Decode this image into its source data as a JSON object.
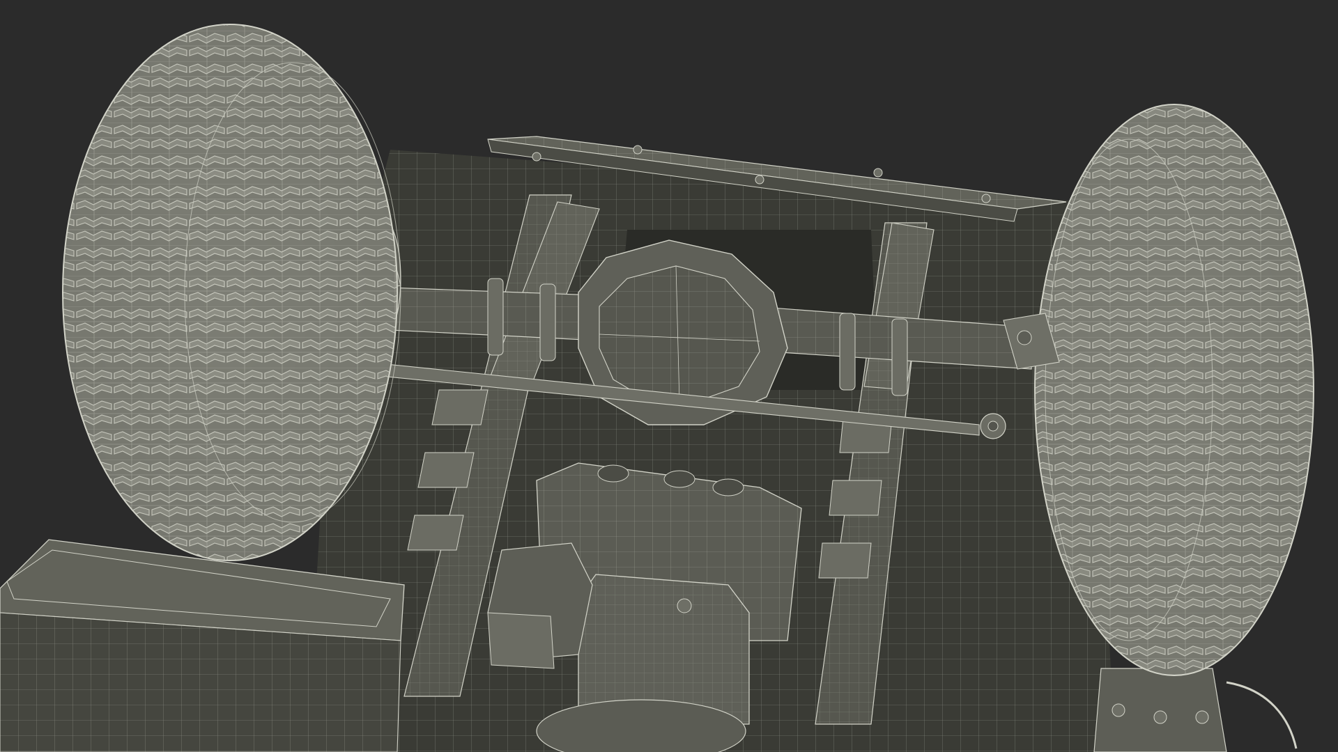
{
  "scene": {
    "subject": "truck-rear-chassis-underside-wireframe",
    "colors": {
      "background": "#2b2b2b",
      "shadow": "#1c1d1a",
      "body_dark": "#3e3f38",
      "body": "#56574f",
      "body_light": "#6b6c63",
      "tire": "#7b7c73",
      "tire_light": "#8e8f85",
      "wire": "#d2d3c8"
    }
  }
}
